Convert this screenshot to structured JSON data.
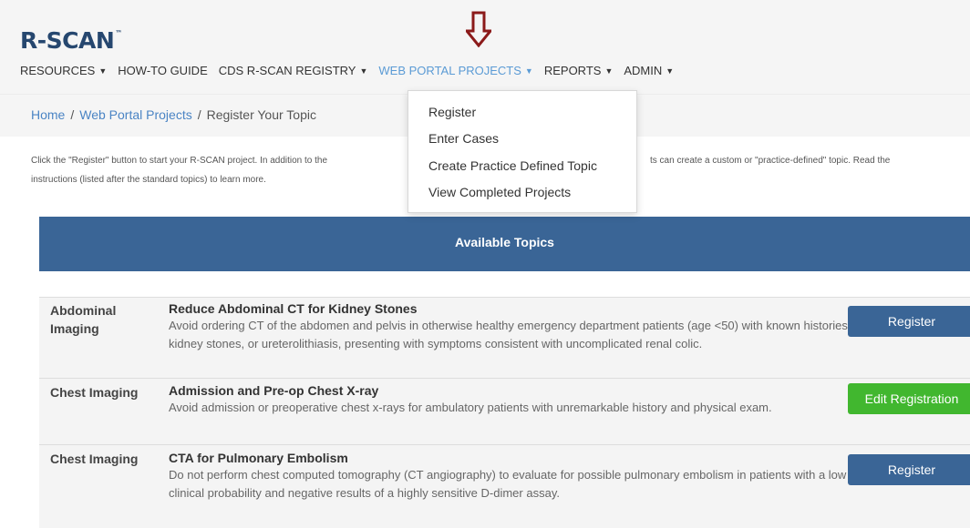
{
  "brand": {
    "name": "R-SCAN",
    "tm": "™"
  },
  "nav": [
    {
      "label": "RESOURCES",
      "caret": true,
      "active": false
    },
    {
      "label": "HOW-TO GUIDE",
      "caret": false,
      "active": false
    },
    {
      "label": "CDS R-SCAN REGISTRY",
      "caret": true,
      "active": false
    },
    {
      "label": "WEB PORTAL PROJECTS",
      "caret": true,
      "active": true
    },
    {
      "label": "REPORTS",
      "caret": true,
      "active": false
    },
    {
      "label": "ADMIN",
      "caret": true,
      "active": false
    }
  ],
  "breadcrumb": {
    "home": "Home",
    "section": "Web Portal Projects",
    "current": "Register Your Topic",
    "separator": "/"
  },
  "intro": {
    "line1_left": "Click the \"Register\" button to start your R-SCAN project. In addition to the",
    "line1_right": "ts can create a custom or \"practice-defined\" topic. Read the",
    "line2": "instructions (listed after the standard topics) to learn more."
  },
  "dropdown": {
    "items": [
      "Register",
      "Enter Cases",
      "Create Practice Defined Topic",
      "View Completed Projects"
    ]
  },
  "table": {
    "header": "Available Topics",
    "rows": [
      {
        "category": "Abdominal Imaging",
        "title": "Reduce Abdominal CT for Kidney Stones",
        "description": "Avoid ordering CT of the abdomen and pelvis in otherwise healthy emergency department patients (age <50) with known histories of kidney stones, or ureterolithiasis, presenting with symptoms consistent with uncomplicated renal colic.",
        "action": "Register",
        "action_style": "blue"
      },
      {
        "category": "Chest Imaging",
        "title": "Admission and Pre-op Chest X-ray",
        "description": "Avoid admission or preoperative chest x-rays for ambulatory patients with unremarkable history and physical exam.",
        "action": "Edit Registration",
        "action_style": "green"
      },
      {
        "category": "Chest Imaging",
        "title": "CTA for Pulmonary Embolism",
        "description": "Do not perform chest computed tomography (CT angiography) to evaluate for possible pulmonary embolism in patients with a low clinical probability and negative results of a highly sensitive D-dimer assay.",
        "action": "Register",
        "action_style": "blue"
      }
    ]
  },
  "colors": {
    "brand": "#26476f",
    "nav_active": "#5b9bd5",
    "table_header": "#3a6596",
    "button_blue": "#3a6596",
    "button_green": "#41b72f",
    "arrow": "#8b1a1a"
  }
}
